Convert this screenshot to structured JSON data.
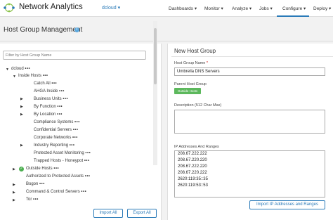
{
  "app": {
    "title": "Network Analytics",
    "tenant": "dcloud ▾"
  },
  "nav": {
    "items": [
      {
        "label": "Dashboards ▾"
      },
      {
        "label": "Monitor ▾"
      },
      {
        "label": "Analyze ▾"
      },
      {
        "label": "Jobs ▾"
      },
      {
        "label": "Configure ▾"
      },
      {
        "label": "Deploy ▾"
      }
    ],
    "active": "Configure ▾"
  },
  "page": {
    "title": "Host Group Management",
    "info_icon": "i"
  },
  "filter": {
    "placeholder": "Filter by Host Group Name"
  },
  "tree": [
    {
      "label": "dcloud",
      "dots": "•••"
    },
    {
      "label": "Inside Hosts",
      "dots": "•••"
    },
    {
      "label": "Catch All",
      "dots": "•••"
    },
    {
      "label": "AHGA Inside",
      "dots": "•••"
    },
    {
      "label": "Business Units",
      "dots": "•••"
    },
    {
      "label": "By Function",
      "dots": "•••"
    },
    {
      "label": "By Location",
      "dots": "•••"
    },
    {
      "label": "Compliance Systems",
      "dots": "•••"
    },
    {
      "label": "Confidential Servers",
      "dots": "•••"
    },
    {
      "label": "Corporate Networks",
      "dots": "•••"
    },
    {
      "label": "Industry Reporting",
      "dots": "•••"
    },
    {
      "label": "Protected Asset Monitoring",
      "dots": "•••"
    },
    {
      "label": "Trapped Hosts - Honeypot",
      "dots": "•••"
    },
    {
      "label": "Outside Hosts",
      "dots": "•••"
    },
    {
      "label": "Authorized to Protected Assets",
      "dots": "•••"
    },
    {
      "label": "Bogon",
      "dots": "•••"
    },
    {
      "label": "Command & Control Servers",
      "dots": "•••"
    },
    {
      "label": "Tor",
      "dots": "•••"
    }
  ],
  "buttons": {
    "import_all": "Import All",
    "export_all": "Export All",
    "import_ips": "Import IP Addresses and Ranges"
  },
  "form": {
    "title": "New Host Group",
    "name_label": "Host Group Name",
    "required_mark": "*",
    "name_value": "Umbrella DNS Servers",
    "parent_label": "Parent Host Group",
    "parent_value": "Outside Hosts",
    "description_label": "Description (512 Char Max)",
    "ip_label": "IP Addresses And Ranges",
    "ips": [
      "208.67.222.222",
      "208.67.220.220",
      "208.67.222.220",
      "208.67.220.222",
      "2620:119:35::35",
      "2620:119:53::53"
    ]
  },
  "colors": {
    "accent": "#2a7ab8",
    "badge": "#5cb85c",
    "check": "#4caf50"
  }
}
